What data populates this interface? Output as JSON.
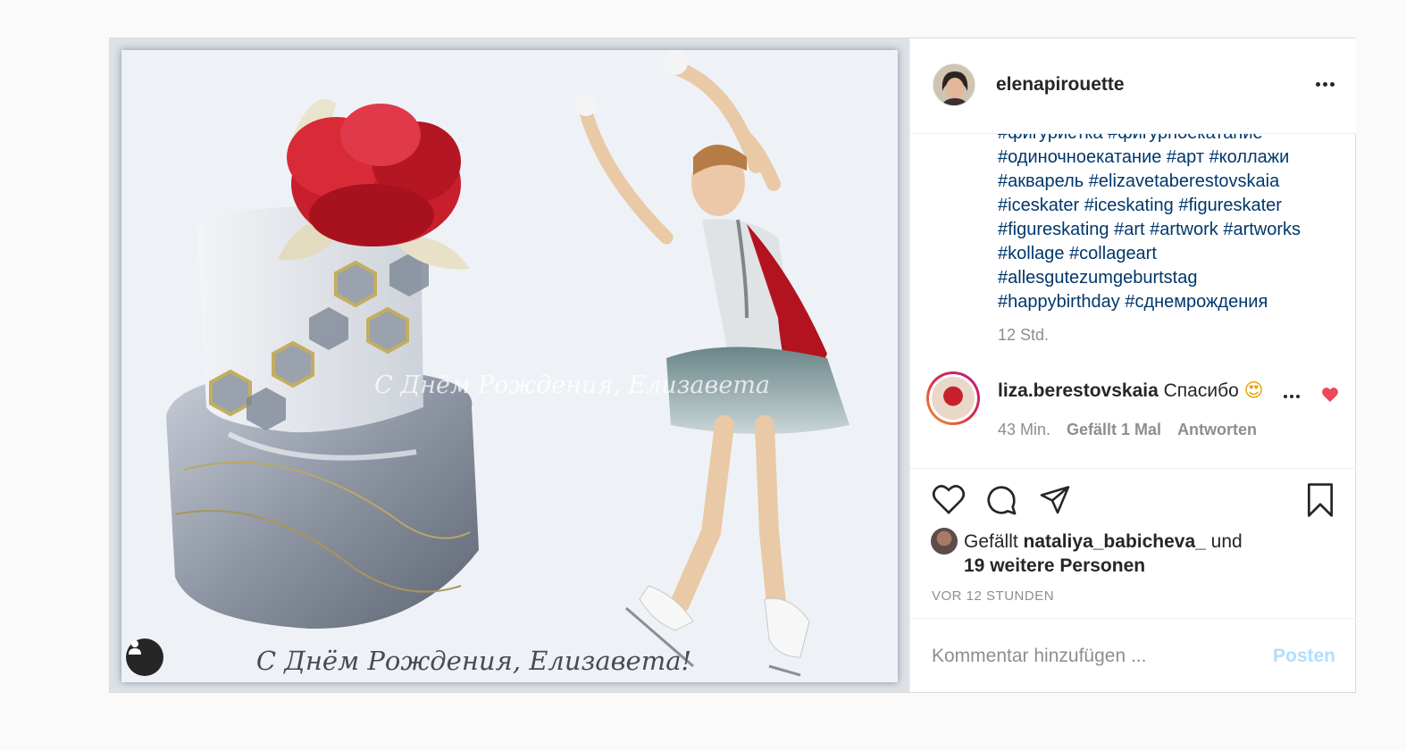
{
  "post": {
    "username": "elenapirouette",
    "image": {
      "caption_text": "С Днём Рождения, Елизавета!",
      "watermark_text": "С Днём Рождения, Елизавета"
    },
    "hashtags": [
      "#фигуристка #фигурноекатание",
      "#одиночноекатание #арт #коллажи",
      "#акварель #elizavetaberestovskaia",
      "#iceskater #iceskating #figureskater",
      "#figureskating #art #artwork #artworks",
      "#kollage #collageart",
      "#allesgutezumgeburtstag",
      "#happybirthday #сднемрождения"
    ],
    "caption_time": "12 Std.",
    "reply": {
      "username": "liza.berestovskaia",
      "text": "Спасибо",
      "emoji": "😍",
      "time": "43 Min.",
      "likes": "Gefällt 1 Mal",
      "reply_label": "Antworten"
    },
    "likes": {
      "prefix": "Gefällt",
      "user": "nataliya_babicheva_",
      "connector": "und",
      "others": "19 weitere Personen"
    },
    "timestamp": "VOR 12 STUNDEN",
    "comment": {
      "placeholder": "Kommentar hinzufügen ...",
      "post_label": "Posten"
    }
  },
  "icons": {
    "more": "more-horizontal-icon",
    "like": "heart-outline-icon",
    "comment": "comment-bubble-icon",
    "share": "paper-plane-icon",
    "save": "bookmark-icon",
    "reply_like": "heart-filled-icon",
    "tag": "user-tag-icon"
  },
  "colors": {
    "hashtag": "#00376b",
    "muted": "#8e8e8e",
    "heart": "#ed4956",
    "post_button": "#b2dffc"
  }
}
